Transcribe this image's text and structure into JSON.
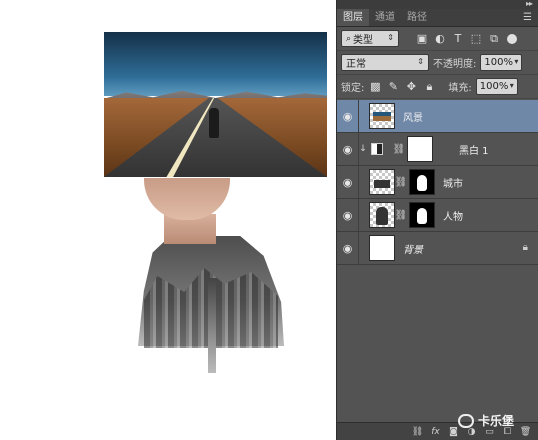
{
  "panel": {
    "tabs": [
      {
        "label": "图层",
        "active": true
      },
      {
        "label": "通道",
        "active": false
      },
      {
        "label": "路径",
        "active": false
      }
    ],
    "filter": {
      "kind": "类型"
    },
    "blend": {
      "mode": "正常",
      "opacity_label": "不透明度:",
      "opacity": "100%"
    },
    "lock": {
      "label": "锁定:",
      "fill_label": "填充:",
      "fill": "100%"
    }
  },
  "layers": [
    {
      "name": "风景",
      "selected": true
    },
    {
      "name": "黑白 1",
      "selected": false
    },
    {
      "name": "城市",
      "selected": false
    },
    {
      "name": "人物",
      "selected": false
    },
    {
      "name": "背景",
      "selected": false,
      "locked": true
    }
  ],
  "bottom_icons": [
    "link-icon",
    "fx-icon",
    "mask-icon",
    "adjustment-icon",
    "folder-icon",
    "new-layer-icon",
    "trash-icon"
  ],
  "watermark": {
    "text": "卡乐堡"
  }
}
